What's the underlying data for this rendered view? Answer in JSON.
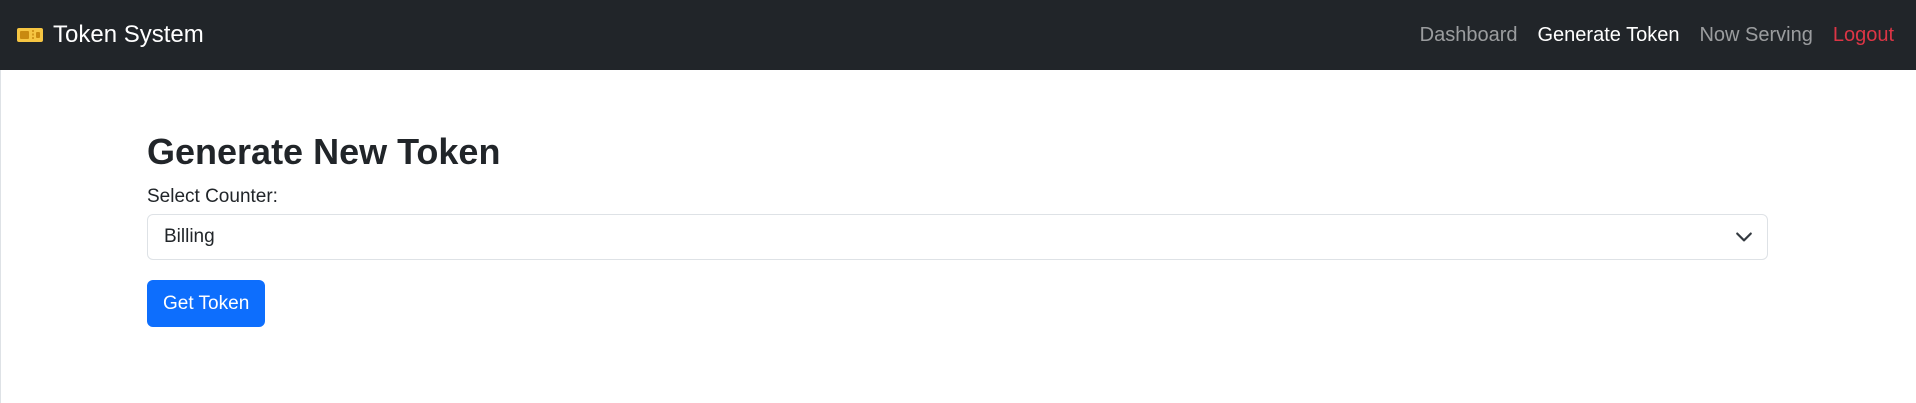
{
  "navbar": {
    "brand": {
      "icon": "ticket-icon",
      "label": "Token System"
    },
    "links": [
      {
        "label": "Dashboard",
        "state": "muted"
      },
      {
        "label": "Generate Token",
        "state": "active"
      },
      {
        "label": "Now Serving",
        "state": "muted"
      },
      {
        "label": "Logout",
        "state": "danger"
      }
    ]
  },
  "main": {
    "title": "Generate New Token",
    "counter_label": "Select Counter:",
    "counter_select": {
      "value": "Billing",
      "icon": "chevron-down-icon"
    },
    "submit_label": "Get Token"
  },
  "colors": {
    "navbar_bg": "#212529",
    "primary": "#0d6efd",
    "danger": "#dc3545",
    "ticket_icon": "#f5c542"
  }
}
